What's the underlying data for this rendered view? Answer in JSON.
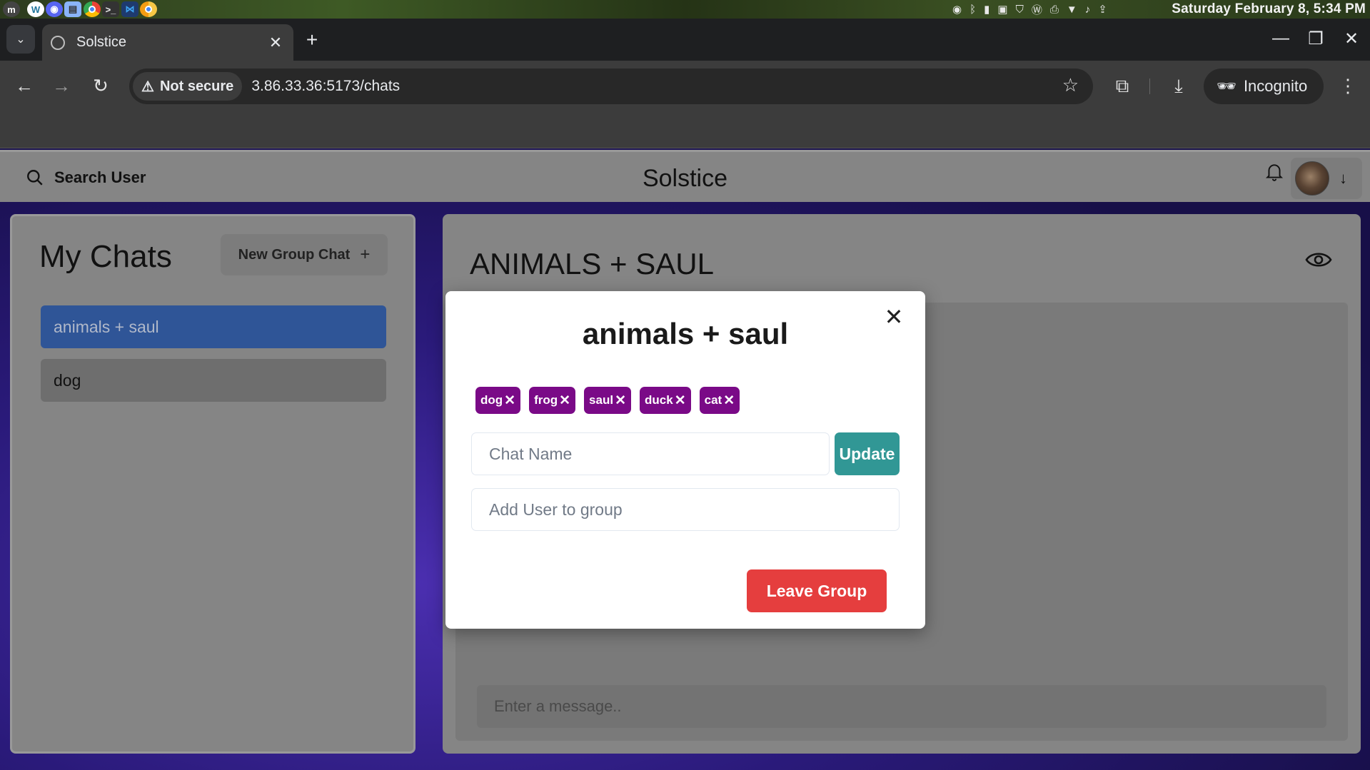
{
  "os": {
    "clock": "Saturday February  8,  5:34 PM",
    "apps": [
      "mint-menu-icon",
      "wordpress-icon",
      "discord-icon",
      "files-icon",
      "chrome-icon",
      "terminal-icon",
      "vscode-icon",
      "chrome-canary-icon"
    ],
    "tray": [
      "discord-tray-icon",
      "bluetooth-icon",
      "battery-icon",
      "clipboard-icon",
      "shield-icon",
      "wordpress-tray-icon",
      "printer-icon",
      "wifi-icon",
      "music-icon",
      "update-icon"
    ]
  },
  "browser": {
    "tab_title": "Solstice",
    "security_label": "Not secure",
    "url": "3.86.33.36:5173/chats",
    "incognito_label": "Incognito"
  },
  "header": {
    "search_label": "Search User",
    "app_title": "Solstice"
  },
  "sidebar": {
    "title": "My Chats",
    "new_group_label": "New Group Chat",
    "chats": [
      {
        "label": "animals + saul"
      },
      {
        "label": "dog"
      }
    ]
  },
  "chat": {
    "heading": "ANIMALS + SAUL",
    "message_placeholder": "Enter a message.."
  },
  "modal": {
    "title": "animals + saul",
    "members": [
      "dog",
      "frog",
      "saul",
      "duck",
      "cat"
    ],
    "chat_name_placeholder": "Chat Name",
    "update_label": "Update",
    "add_user_placeholder": "Add User to group",
    "leave_label": "Leave Group"
  },
  "colors": {
    "chip": "#7a0a87",
    "update": "#319795",
    "leave": "#e53e3e",
    "active_chat": "#2f5597"
  }
}
